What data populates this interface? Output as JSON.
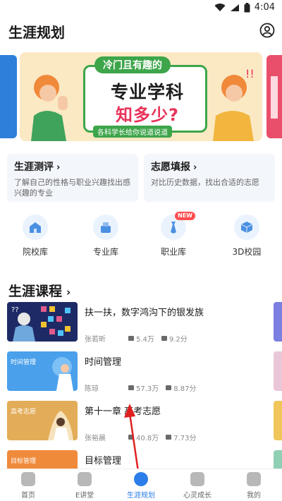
{
  "status": {
    "time": "4:04"
  },
  "header": {
    "title": "生涯规划"
  },
  "banner": {
    "top_pill": "冷门且有趣的",
    "line1": "专业学科",
    "line2": "知多少?",
    "sub": "各科学长给你说道说道"
  },
  "cards": [
    {
      "title": "生涯测评",
      "desc": "了解自己的性格与职业兴趣找出感兴趣的专业"
    },
    {
      "title": "志愿填报",
      "desc": "对比历史数据，找出合适的志愿"
    }
  ],
  "quick_links": [
    {
      "label": "院校库",
      "icon": "school-icon"
    },
    {
      "label": "专业库",
      "icon": "major-icon"
    },
    {
      "label": "职业库",
      "icon": "career-icon",
      "badge": "NEW"
    },
    {
      "label": "3D校园",
      "icon": "cube-icon"
    }
  ],
  "courses_section": {
    "title": "生涯课程"
  },
  "courses": [
    {
      "title": "扶一扶，数字鸿沟下的银发族",
      "author": "张若昕",
      "views": "5.4万",
      "score": "9.2分",
      "thumb_label": ""
    },
    {
      "title": "时间管理",
      "author": "陈琼",
      "views": "57.3万",
      "score": "8.87分",
      "thumb_label": "时间管理"
    },
    {
      "title": "第十一章 高考志愿",
      "author": "张裕晨",
      "views": "40.8万",
      "score": "7.73分",
      "thumb_label": "高考志愿"
    },
    {
      "title": "目标管理",
      "author": "",
      "views": "",
      "score": "",
      "thumb_label": "目标管理"
    }
  ],
  "tabs": [
    {
      "label": "首页",
      "icon": "home-icon",
      "active": false
    },
    {
      "label": "E讲堂",
      "icon": "video-icon",
      "active": false
    },
    {
      "label": "生涯规划",
      "icon": "compass-icon",
      "active": true
    },
    {
      "label": "心灵成长",
      "icon": "feather-icon",
      "active": false
    },
    {
      "label": "我的",
      "icon": "user-icon",
      "active": false
    }
  ],
  "colors": {
    "accent": "#2b7de9",
    "banner_green": "#3da54a",
    "banner_red": "#e8335a"
  }
}
